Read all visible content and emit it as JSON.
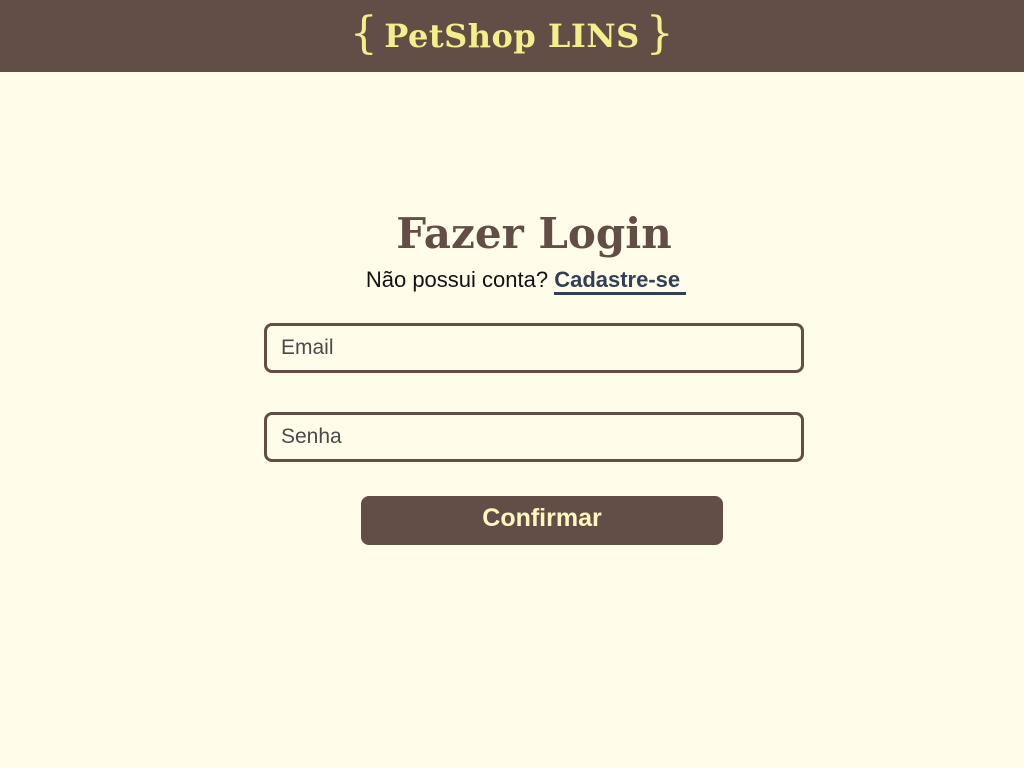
{
  "header": {
    "brand": "PetShop LINS",
    "brace_open": "{",
    "brace_close": "}"
  },
  "login": {
    "title": "Fazer Login",
    "no_account_text": "Não possui conta?",
    "signup_link": "Cadastre-se",
    "email_placeholder": "Email",
    "password_placeholder": "Senha",
    "confirm_label": "Confirmar"
  },
  "colors": {
    "header_bg": "#634e47",
    "logo_text": "#f6ed8b",
    "page_bg": "#fffde9",
    "link": "#333f56",
    "button_text": "#fff7bf"
  }
}
